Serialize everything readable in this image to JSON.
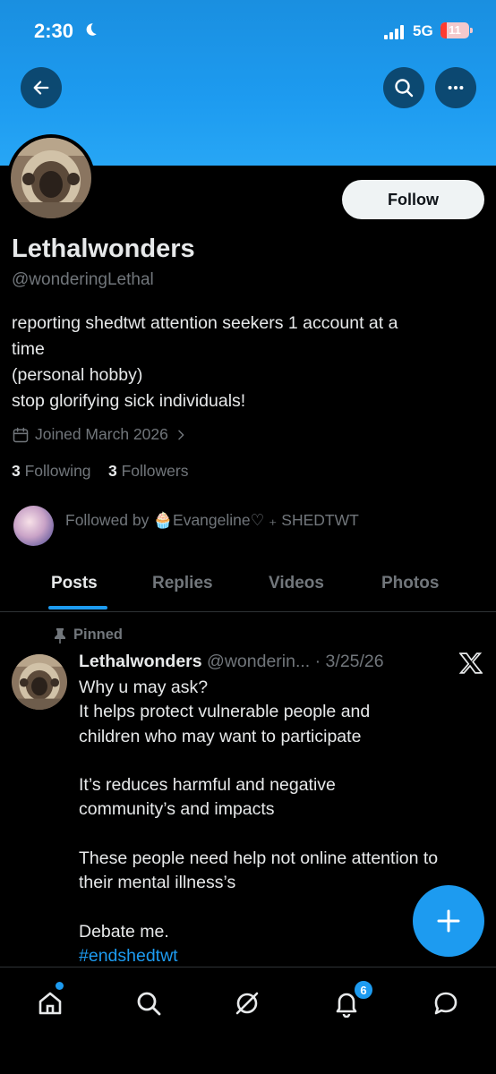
{
  "status_bar": {
    "time": "2:30",
    "network": "5G",
    "battery": "11"
  },
  "profile": {
    "name": "Lethalwonders",
    "handle": "@wonderingLethal",
    "follow_label": "Follow",
    "bio_lines": [
      "reporting shedtwt attention seekers 1 account at a",
      "time",
      "(personal hobby)",
      "stop glorifying sick individuals!"
    ],
    "joined": "Joined March 2026",
    "following_count": "3",
    "following_label": "Following",
    "followers_count": "3",
    "followers_label": "Followers",
    "followed_by": "Followed by 🧁Evangeline♡ ₊ SHEDTWT"
  },
  "tabs": [
    "Posts",
    "Replies",
    "Videos",
    "Photos"
  ],
  "active_tab": "Posts",
  "pinned_post": {
    "pinned_label": "Pinned",
    "author": "Lethalwonders",
    "handle": "@wonderin...",
    "date": "· 3/25/26",
    "body_lines": [
      "Why u may ask?",
      " It helps protect vulnerable people and",
      "children who may want to participate",
      "",
      "It’s reduces harmful and negative",
      "community’s and impacts",
      "",
      "These people need help not online attention to",
      "their mental illness’s",
      "",
      "Debate me."
    ],
    "hashtag": "#endshedtwt"
  },
  "bottom_nav": {
    "items": [
      "home-icon",
      "search-icon",
      "grok-icon",
      "notifications-icon",
      "messages-icon"
    ],
    "notifications_badge": "6"
  },
  "colors": {
    "accent": "#1d9bf0",
    "background": "#000000",
    "text": "#e7e9ea",
    "muted": "#71767b"
  }
}
